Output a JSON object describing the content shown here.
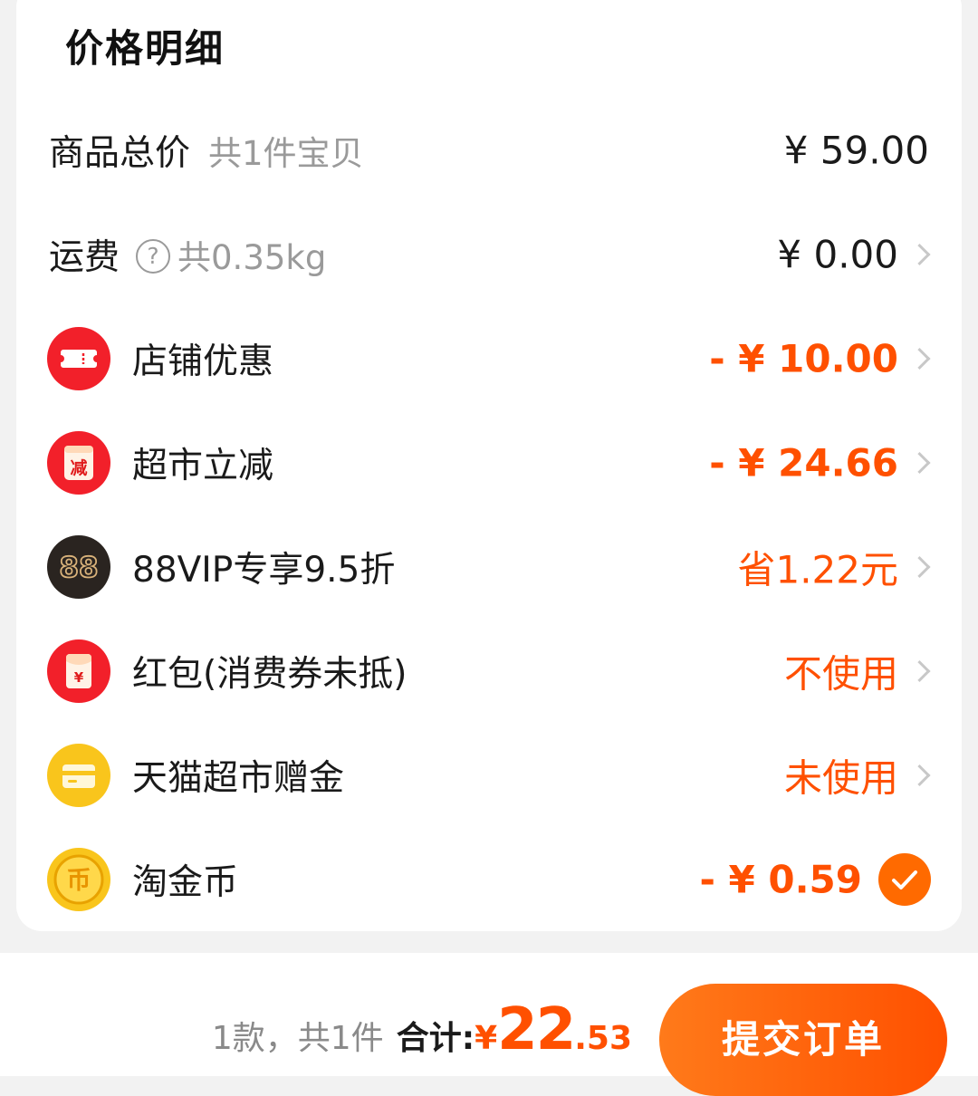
{
  "section": {
    "title": "价格明细"
  },
  "rows": {
    "goods": {
      "label": "商品总价",
      "sub": "共1件宝贝",
      "value": "¥ 59.00"
    },
    "shipping": {
      "label": "运费",
      "help": "?",
      "sub": "共0.35kg",
      "value": "¥ 0.00"
    },
    "store_discount": {
      "label": "店铺优惠",
      "value": "- ¥ 10.00"
    },
    "market_cut": {
      "label": "超市立减",
      "icon_text": "减",
      "value": "- ¥ 24.66"
    },
    "vip": {
      "label": "88VIP专享9.5折",
      "icon_text": "88",
      "value": "省1.22元"
    },
    "red_packet": {
      "label": "红包(消费券未抵)",
      "icon_text": "¥",
      "value": "不使用"
    },
    "tmall_gift": {
      "label": "天猫超市赠金",
      "value": "未使用"
    },
    "coin": {
      "label": "淘金币",
      "icon_text": "币",
      "value": "- ¥ 0.59"
    }
  },
  "footer": {
    "count": "1款，共1件",
    "total_label": "合计:",
    "currency": "¥",
    "amount_int": "22",
    "amount_dec": ".53",
    "submit_label": "提交订单"
  },
  "colors": {
    "accent": "#ff5000",
    "red_icon": "#f2202a",
    "dark_icon": "#2a2420",
    "gold": "#d9b27a",
    "yellow_icon": "#f9c51c"
  },
  "icons": {
    "store_discount": "ticket-icon",
    "market_cut": "cut-badge-icon",
    "vip": "88vip-icon",
    "red_packet": "red-packet-icon",
    "tmall_gift": "gift-card-icon",
    "coin": "coin-icon",
    "row_arrow": "chevron-right-icon",
    "selected": "check-icon"
  }
}
